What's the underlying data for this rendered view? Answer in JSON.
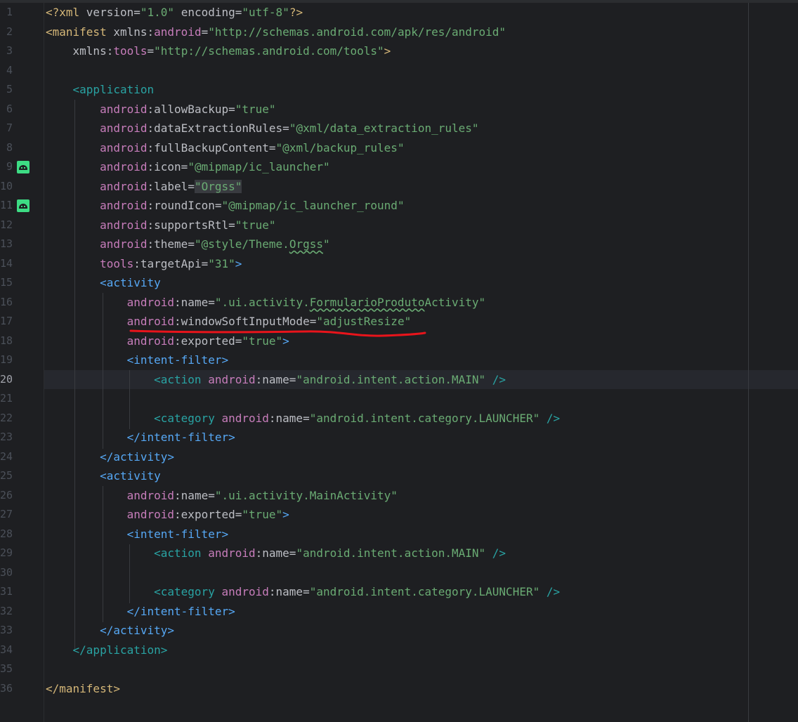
{
  "editor": {
    "current_line": "20",
    "lines": [
      {
        "n": "1",
        "tokens": [
          [
            "pi",
            "<?xml "
          ],
          [
            "attr",
            "version"
          ],
          [
            "eq",
            "="
          ],
          [
            "str",
            "\"1.0\""
          ],
          [
            "plain",
            " "
          ],
          [
            "attr",
            "encoding"
          ],
          [
            "eq",
            "="
          ],
          [
            "str",
            "\"utf-8\""
          ],
          [
            "pi",
            "?>"
          ]
        ]
      },
      {
        "n": "2",
        "tokens": [
          [
            "tagname",
            "<manifest "
          ],
          [
            "attr",
            "xmlns"
          ],
          [
            "plain",
            ":"
          ],
          [
            "ns",
            "android"
          ],
          [
            "eq",
            "="
          ],
          [
            "str",
            "\"http://schemas.android.com/apk/res/android\""
          ]
        ]
      },
      {
        "n": "3",
        "tokens": [
          [
            "plain",
            "    "
          ],
          [
            "attr",
            "xmlns"
          ],
          [
            "plain",
            ":"
          ],
          [
            "ns",
            "tools"
          ],
          [
            "eq",
            "="
          ],
          [
            "str",
            "\"http://schemas.android.com/tools\""
          ],
          [
            "tagname",
            ">"
          ]
        ]
      },
      {
        "n": "4",
        "tokens": []
      },
      {
        "n": "5",
        "tokens": [
          [
            "plain",
            "    "
          ],
          [
            "green",
            "<application"
          ]
        ]
      },
      {
        "n": "6",
        "tokens": [
          [
            "plain",
            "        "
          ],
          [
            "ns",
            "android"
          ],
          [
            "plain",
            ":"
          ],
          [
            "attr",
            "allowBackup"
          ],
          [
            "eq",
            "="
          ],
          [
            "str",
            "\"true\""
          ]
        ]
      },
      {
        "n": "7",
        "tokens": [
          [
            "plain",
            "        "
          ],
          [
            "ns",
            "android"
          ],
          [
            "plain",
            ":"
          ],
          [
            "attr",
            "dataExtractionRules"
          ],
          [
            "eq",
            "="
          ],
          [
            "str",
            "\"@xml/data_extraction_rules\""
          ]
        ]
      },
      {
        "n": "8",
        "tokens": [
          [
            "plain",
            "        "
          ],
          [
            "ns",
            "android"
          ],
          [
            "plain",
            ":"
          ],
          [
            "attr",
            "fullBackupContent"
          ],
          [
            "eq",
            "="
          ],
          [
            "str",
            "\"@xml/backup_rules\""
          ]
        ]
      },
      {
        "n": "9",
        "icon": "android-icon",
        "tokens": [
          [
            "plain",
            "        "
          ],
          [
            "ns",
            "android"
          ],
          [
            "plain",
            ":"
          ],
          [
            "attr",
            "icon"
          ],
          [
            "eq",
            "="
          ],
          [
            "str",
            "\"@mipmap/ic_launcher\""
          ]
        ]
      },
      {
        "n": "10",
        "tokens": [
          [
            "plain",
            "        "
          ],
          [
            "ns",
            "android"
          ],
          [
            "plain",
            ":"
          ],
          [
            "attr",
            "label"
          ],
          [
            "eq",
            "="
          ],
          [
            "strhl",
            "\"Orgss\""
          ]
        ]
      },
      {
        "n": "11",
        "icon": "android-icon",
        "tokens": [
          [
            "plain",
            "        "
          ],
          [
            "ns",
            "android"
          ],
          [
            "plain",
            ":"
          ],
          [
            "attr",
            "roundIcon"
          ],
          [
            "eq",
            "="
          ],
          [
            "str",
            "\"@mipmap/ic_launcher_round\""
          ]
        ]
      },
      {
        "n": "12",
        "tokens": [
          [
            "plain",
            "        "
          ],
          [
            "ns",
            "android"
          ],
          [
            "plain",
            ":"
          ],
          [
            "attr",
            "supportsRtl"
          ],
          [
            "eq",
            "="
          ],
          [
            "str",
            "\"true\""
          ]
        ]
      },
      {
        "n": "13",
        "tokens": [
          [
            "plain",
            "        "
          ],
          [
            "ns",
            "android"
          ],
          [
            "plain",
            ":"
          ],
          [
            "attr",
            "theme"
          ],
          [
            "eq",
            "="
          ],
          [
            "str",
            "\"@style/Theme."
          ],
          [
            "strsq",
            "Orgss"
          ],
          [
            "str",
            "\""
          ]
        ]
      },
      {
        "n": "14",
        "tokens": [
          [
            "plain",
            "        "
          ],
          [
            "ns",
            "tools"
          ],
          [
            "plain",
            ":"
          ],
          [
            "attr",
            "targetApi"
          ],
          [
            "eq",
            "="
          ],
          [
            "str",
            "\"31\""
          ],
          [
            "tag",
            ">"
          ]
        ]
      },
      {
        "n": "15",
        "tokens": [
          [
            "plain",
            "        "
          ],
          [
            "tag",
            "<activity"
          ]
        ]
      },
      {
        "n": "16",
        "tokens": [
          [
            "plain",
            "            "
          ],
          [
            "ns",
            "android"
          ],
          [
            "plain",
            ":"
          ],
          [
            "attr",
            "name"
          ],
          [
            "eq",
            "="
          ],
          [
            "str",
            "\".ui.activity."
          ],
          [
            "strsq",
            "FormularioProduto"
          ],
          [
            "str",
            "Activity\""
          ]
        ]
      },
      {
        "n": "17",
        "tokens": [
          [
            "plain",
            "            "
          ],
          [
            "ns",
            "android"
          ],
          [
            "plain",
            ":"
          ],
          [
            "attr",
            "windowSoftInputMode"
          ],
          [
            "eq",
            "="
          ],
          [
            "str",
            "\"adjustResize\""
          ]
        ]
      },
      {
        "n": "18",
        "tokens": [
          [
            "plain",
            "            "
          ],
          [
            "ns",
            "android"
          ],
          [
            "plain",
            ":"
          ],
          [
            "attr",
            "exported"
          ],
          [
            "eq",
            "="
          ],
          [
            "str",
            "\"true\""
          ],
          [
            "tag",
            ">"
          ]
        ]
      },
      {
        "n": "19",
        "tokens": [
          [
            "plain",
            "            "
          ],
          [
            "tag",
            "<intent-filter>"
          ]
        ]
      },
      {
        "n": "20",
        "tokens": [
          [
            "plain",
            "                "
          ],
          [
            "green",
            "<action "
          ],
          [
            "ns",
            "android"
          ],
          [
            "plain",
            ":"
          ],
          [
            "attr",
            "name"
          ],
          [
            "eq",
            "="
          ],
          [
            "str",
            "\"android.intent.action.MAIN\""
          ],
          [
            "green",
            " />"
          ]
        ]
      },
      {
        "n": "21",
        "tokens": []
      },
      {
        "n": "22",
        "tokens": [
          [
            "plain",
            "                "
          ],
          [
            "green",
            "<category "
          ],
          [
            "ns",
            "android"
          ],
          [
            "plain",
            ":"
          ],
          [
            "attr",
            "name"
          ],
          [
            "eq",
            "="
          ],
          [
            "str",
            "\"android.intent.category.LAUNCHER\""
          ],
          [
            "green",
            " />"
          ]
        ]
      },
      {
        "n": "23",
        "tokens": [
          [
            "plain",
            "            "
          ],
          [
            "tag",
            "</intent-filter>"
          ]
        ]
      },
      {
        "n": "24",
        "tokens": [
          [
            "plain",
            "        "
          ],
          [
            "tag",
            "</activity>"
          ]
        ]
      },
      {
        "n": "25",
        "tokens": [
          [
            "plain",
            "        "
          ],
          [
            "tag",
            "<activity"
          ]
        ]
      },
      {
        "n": "26",
        "tokens": [
          [
            "plain",
            "            "
          ],
          [
            "ns",
            "android"
          ],
          [
            "plain",
            ":"
          ],
          [
            "attr",
            "name"
          ],
          [
            "eq",
            "="
          ],
          [
            "str",
            "\".ui.activity.MainActivity\""
          ]
        ]
      },
      {
        "n": "27",
        "tokens": [
          [
            "plain",
            "            "
          ],
          [
            "ns",
            "android"
          ],
          [
            "plain",
            ":"
          ],
          [
            "attr",
            "exported"
          ],
          [
            "eq",
            "="
          ],
          [
            "str",
            "\"true\""
          ],
          [
            "tag",
            ">"
          ]
        ]
      },
      {
        "n": "28",
        "tokens": [
          [
            "plain",
            "            "
          ],
          [
            "tag",
            "<intent-filter>"
          ]
        ]
      },
      {
        "n": "29",
        "tokens": [
          [
            "plain",
            "                "
          ],
          [
            "green",
            "<action "
          ],
          [
            "ns",
            "android"
          ],
          [
            "plain",
            ":"
          ],
          [
            "attr",
            "name"
          ],
          [
            "eq",
            "="
          ],
          [
            "str",
            "\"android.intent.action.MAIN\""
          ],
          [
            "green",
            " />"
          ]
        ]
      },
      {
        "n": "30",
        "tokens": []
      },
      {
        "n": "31",
        "tokens": [
          [
            "plain",
            "                "
          ],
          [
            "green",
            "<category "
          ],
          [
            "ns",
            "android"
          ],
          [
            "plain",
            ":"
          ],
          [
            "attr",
            "name"
          ],
          [
            "eq",
            "="
          ],
          [
            "str",
            "\"android.intent.category.LAUNCHER\""
          ],
          [
            "green",
            " />"
          ]
        ]
      },
      {
        "n": "32",
        "tokens": [
          [
            "plain",
            "            "
          ],
          [
            "tag",
            "</intent-filter>"
          ]
        ]
      },
      {
        "n": "33",
        "tokens": [
          [
            "plain",
            "        "
          ],
          [
            "tag",
            "</activity>"
          ]
        ]
      },
      {
        "n": "34",
        "tokens": [
          [
            "plain",
            "    "
          ],
          [
            "green",
            "</application>"
          ]
        ]
      },
      {
        "n": "35",
        "tokens": []
      },
      {
        "n": "36",
        "tokens": [
          [
            "tagname",
            "</manifest>"
          ]
        ]
      }
    ]
  },
  "colors": {
    "background": "#1e1f22",
    "annotation": "#e8141b"
  }
}
